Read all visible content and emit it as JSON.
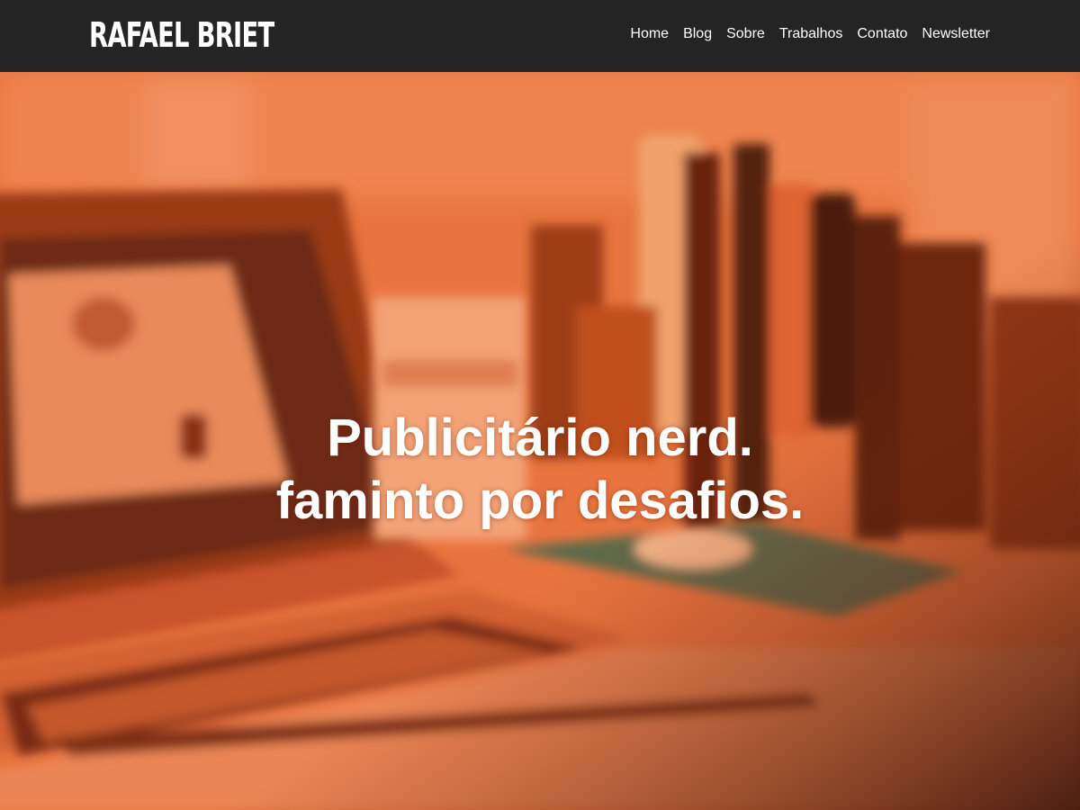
{
  "header": {
    "brand": "RAFAEL BRIET",
    "nav": [
      {
        "label": "Home"
      },
      {
        "label": "Blog"
      },
      {
        "label": "Sobre"
      },
      {
        "label": "Trabalhos"
      },
      {
        "label": "Contato"
      },
      {
        "label": "Newsletter"
      }
    ]
  },
  "hero": {
    "line1": "Publicitário nerd.",
    "line2": "faminto por desafios."
  },
  "colors": {
    "header_bg": "#242424",
    "hero_tint": "#e8703f",
    "text": "#ffffff"
  }
}
